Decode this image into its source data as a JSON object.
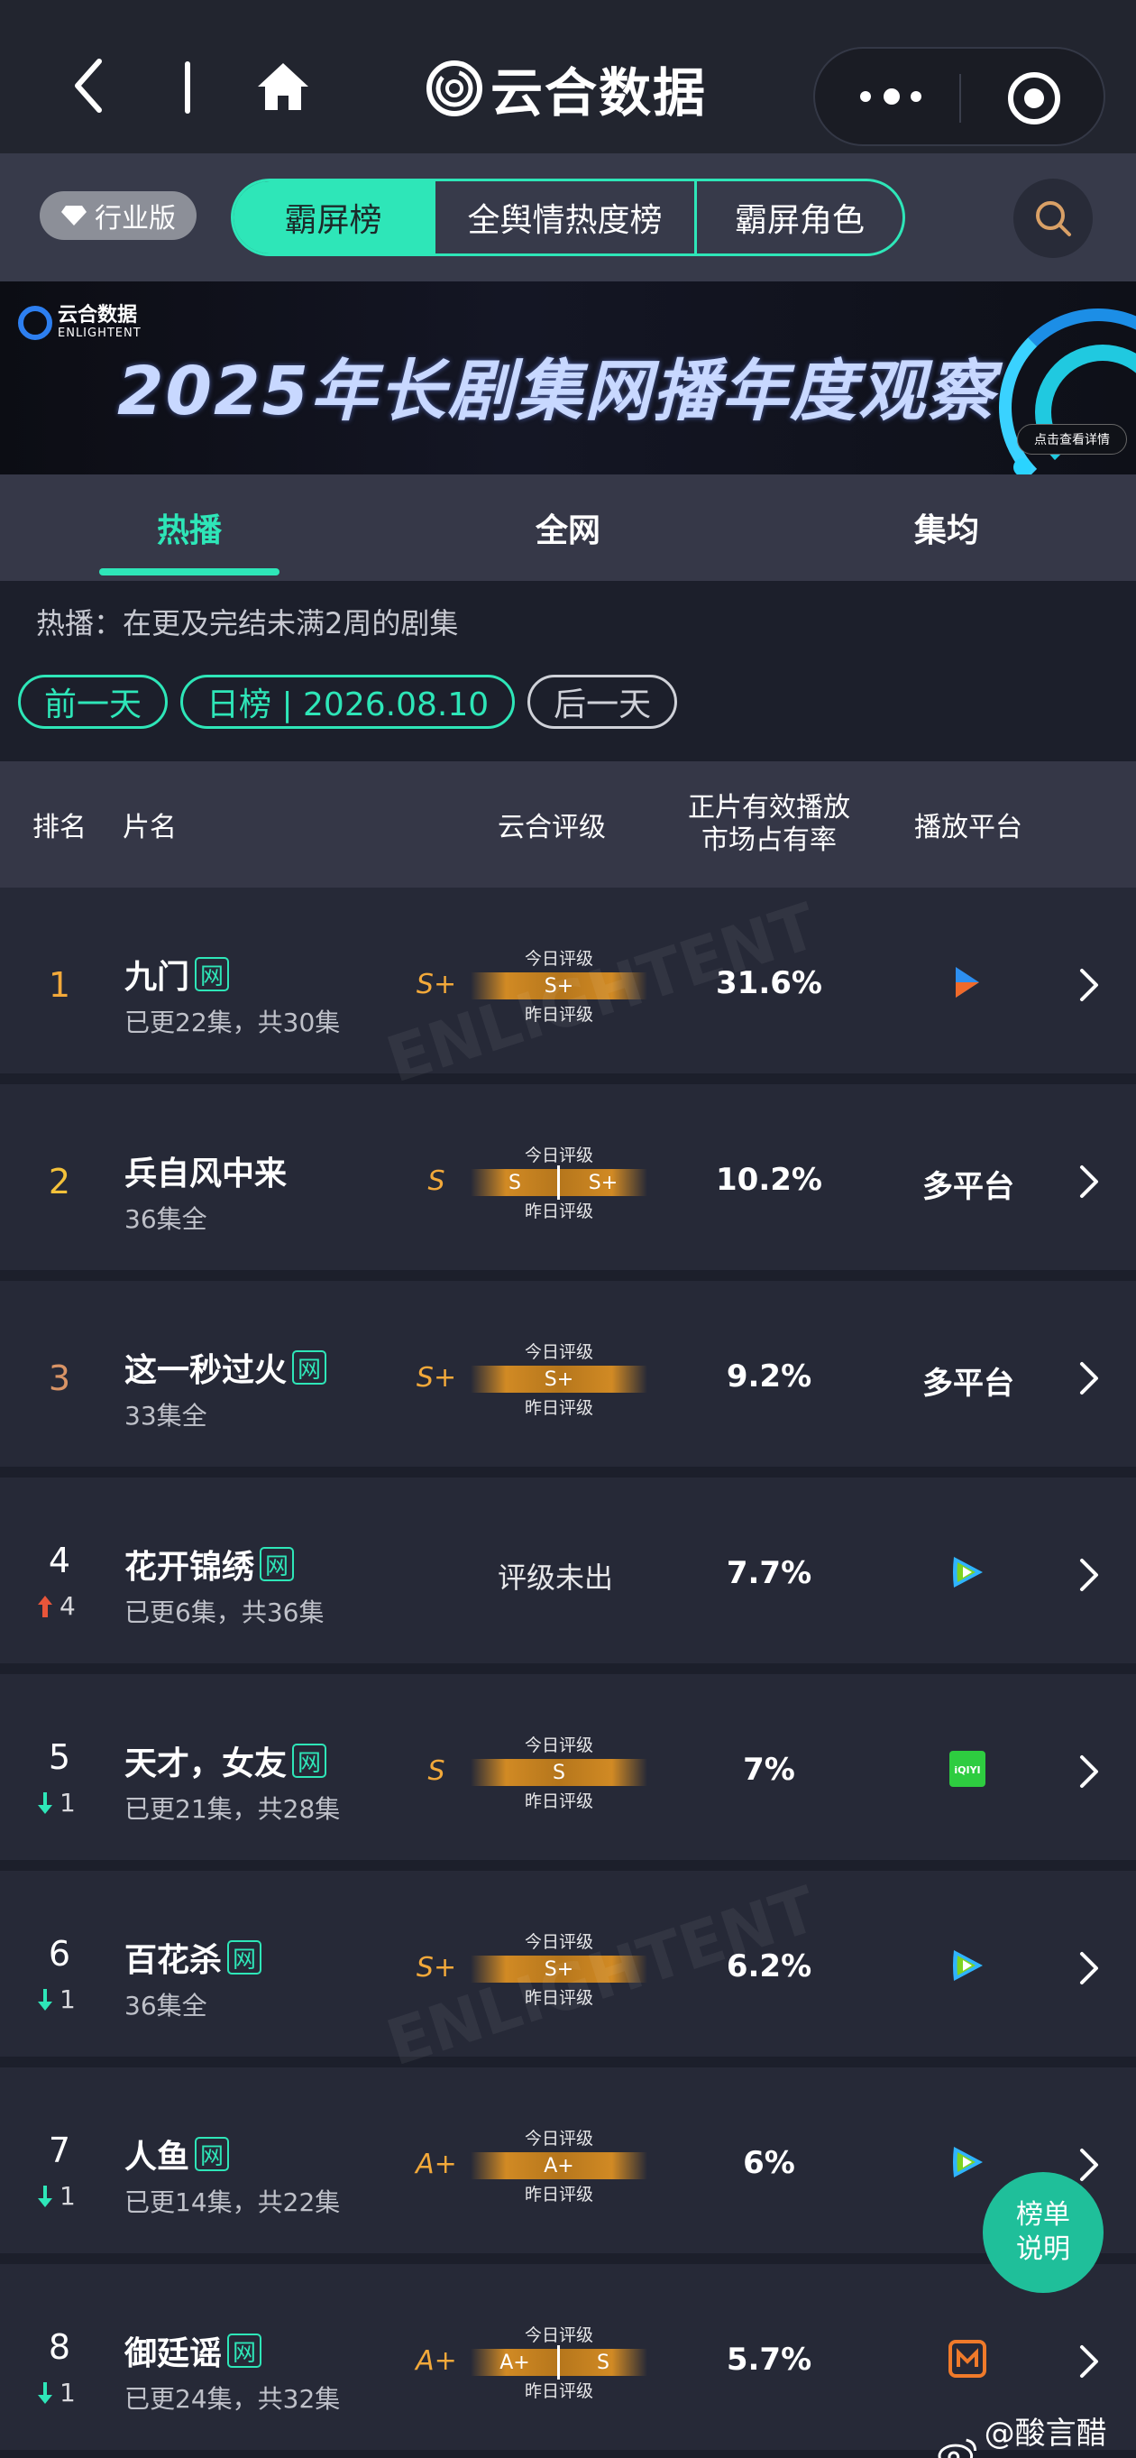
{
  "nav": {
    "brand_name": "云合数据"
  },
  "tabs": {
    "industry_label": "行业版",
    "main": [
      {
        "label": "霸屏榜",
        "active": true
      },
      {
        "label": "全舆情热度榜",
        "active": false
      },
      {
        "label": "霸屏角色",
        "active": false
      }
    ]
  },
  "banner": {
    "logo_cn": "云合数据",
    "logo_en": "ENLIGHTENT",
    "title": "2025年长剧集网播年度观察",
    "cta": "点击查看详情"
  },
  "subtabs": [
    {
      "label": "热播",
      "active": true
    },
    {
      "label": "全网",
      "active": false
    },
    {
      "label": "集均",
      "active": false
    }
  ],
  "description": "热播：在更及完结未满2周的剧集",
  "date_nav": {
    "prev": "前一天",
    "current": "日榜 | 2026.08.10",
    "next": "后一天"
  },
  "table": {
    "headers": {
      "rank": "排名",
      "title": "片名",
      "rating": "云合评级",
      "share_line1": "正片有效播放",
      "share_line2": "市场占有率",
      "platform": "播放平台"
    },
    "rating_today_label": "今日评级",
    "rating_yesterday_label": "昨日评级",
    "rows": [
      {
        "rank": "1",
        "rank_color": "#f3a93a",
        "change": "",
        "title": "九门",
        "net": "网",
        "sub": "已更22集，共30集",
        "grade": "S+",
        "today": "S+",
        "yesterday": "",
        "share": "31.6%",
        "platform": "youku-icon"
      },
      {
        "rank": "2",
        "rank_color": "#f3c13a",
        "change": "",
        "title": "兵自风中来",
        "net": "",
        "sub": "36集全",
        "grade": "S",
        "today": "S",
        "yesterday": "S+",
        "share": "10.2%",
        "platform_text": "多平台"
      },
      {
        "rank": "3",
        "rank_color": "#d99466",
        "change": "",
        "title": "这一秒过火",
        "net": "网",
        "sub": "33集全",
        "grade": "S+",
        "today": "S+",
        "yesterday": "",
        "share": "9.2%",
        "platform_text": "多平台"
      },
      {
        "rank": "4",
        "rank_color": "#ffffff",
        "change": "4",
        "change_dir": "up",
        "title": "花开锦绣",
        "net": "网",
        "sub": "已更6集，共36集",
        "rating_none": "评级未出",
        "share": "7.7%",
        "platform": "tencent-video-icon"
      },
      {
        "rank": "5",
        "rank_color": "#ffffff",
        "change": "1",
        "change_dir": "down",
        "title": "天才，女友",
        "net": "网",
        "sub": "已更21集，共28集",
        "grade": "S",
        "today": "S",
        "yesterday": "",
        "share": "7%",
        "platform": "iqiyi-icon",
        "platform_label": "iQIYI"
      },
      {
        "rank": "6",
        "rank_color": "#ffffff",
        "change": "1",
        "change_dir": "down",
        "title": "百花杀",
        "net": "网",
        "sub": "36集全",
        "grade": "S+",
        "today": "S+",
        "yesterday": "",
        "share": "6.2%",
        "platform": "tencent-video-icon"
      },
      {
        "rank": "7",
        "rank_color": "#ffffff",
        "change": "1",
        "change_dir": "down",
        "title": "人鱼",
        "net": "网",
        "sub": "已更14集，共22集",
        "grade": "A+",
        "today": "A+",
        "yesterday": "",
        "share": "6%",
        "platform": "tencent-video-icon"
      },
      {
        "rank": "8",
        "rank_color": "#ffffff",
        "change": "1",
        "change_dir": "down",
        "title": "御廷谣",
        "net": "网",
        "sub": "已更24集，共32集",
        "grade": "A+",
        "today": "A+",
        "yesterday": "S",
        "share": "5.7%",
        "platform": "mango-tv-icon"
      }
    ]
  },
  "help_button": {
    "line1": "榜单",
    "line2": "说明"
  },
  "watermark_user": "@酸言醋语",
  "colors": {
    "accent": "#2ee6b8",
    "grade": "#f3a93a",
    "background": "#1c1f2b"
  }
}
